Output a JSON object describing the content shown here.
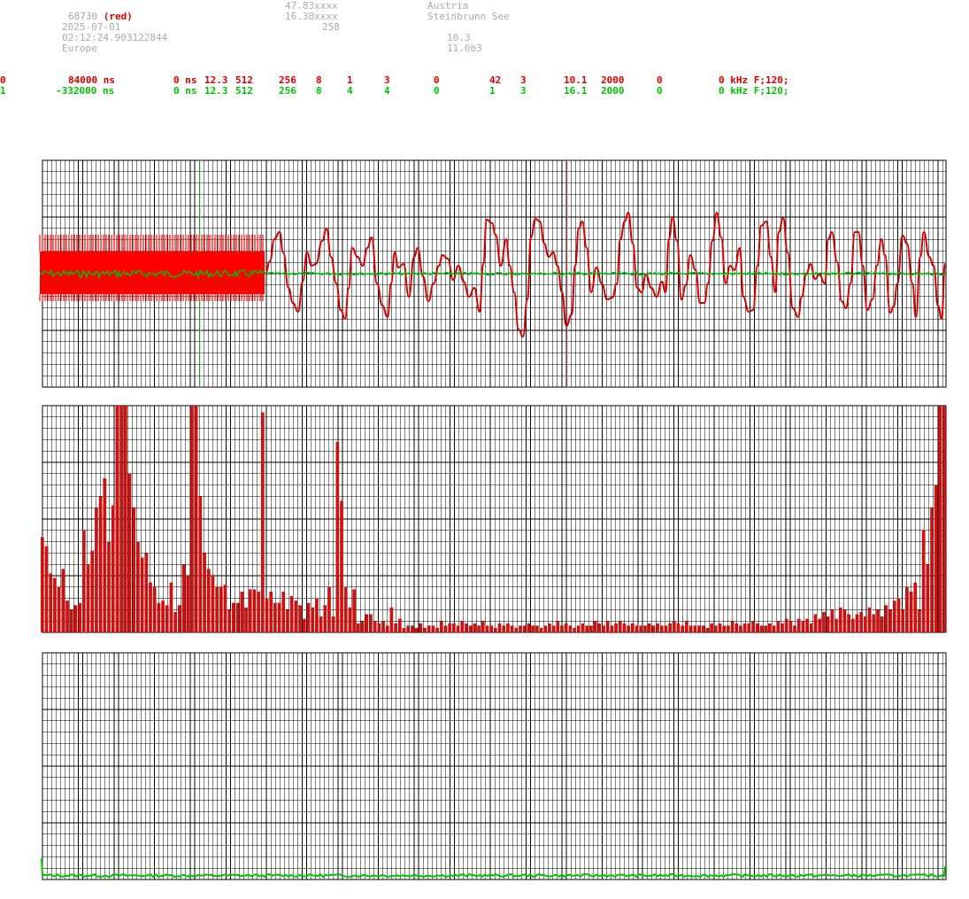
{
  "header": {
    "station_id": "730",
    "station_color_label": "(red)",
    "station_id_2": "687",
    "date": "2025-07-01",
    "time": "02:12:24.903122844",
    "region": "Europe",
    "latitude": "47.83xxxx",
    "longitude": "16.38xxxx",
    "count": "258",
    "country": "Austria",
    "location": "Steinbrunn See",
    "version_a": "10.3",
    "version_b": "11.0b3"
  },
  "channels": [
    {
      "index": "0",
      "offset": "84000 ns",
      "delay": "0 ns",
      "gain": "12.3",
      "fft_size": "512",
      "f1": "256",
      "f2": "8",
      "f3": "1",
      "f4": "3",
      "f5": "0",
      "f6": "42",
      "f7": "3",
      "f8": "10.1",
      "f9": "2000",
      "f10": "0",
      "freq": "0 kHz F;120;",
      "color": "#d40000"
    },
    {
      "index": "1",
      "offset": "-332000 ns",
      "delay": "0 ns",
      "gain": "12.3",
      "fft_size": "512",
      "f1": "256",
      "f2": "8",
      "f3": "4",
      "f4": "4",
      "f5": "0",
      "f6": "1",
      "f7": "3",
      "f8": "16.1",
      "f9": "2000",
      "f10": "0",
      "freq": "0 kHz F;120;",
      "color": "#00c000"
    }
  ],
  "chart_data": [
    {
      "type": "line",
      "panel": "waveform",
      "series": [
        {
          "color": "#d40000",
          "style": "red waveform with dense burst at start"
        },
        {
          "color": "#00c000",
          "style": "green near-flat trace"
        }
      ],
      "grid": true
    },
    {
      "type": "bar",
      "panel": "spectrum",
      "color": "#cc1111",
      "values": [
        42,
        38,
        26,
        24,
        20,
        28,
        14,
        10,
        12,
        13,
        45,
        30,
        36,
        55,
        60,
        68,
        40,
        56,
        100,
        100,
        100,
        70,
        55,
        40,
        33,
        35,
        22,
        20,
        13,
        14,
        12,
        22,
        9,
        12,
        30,
        25,
        100,
        100,
        60,
        35,
        28,
        25,
        20,
        20,
        21,
        10,
        13,
        13,
        18,
        11,
        19,
        19,
        18,
        97,
        15,
        18,
        13,
        13,
        18,
        10,
        16,
        14,
        12,
        6,
        13,
        11,
        15,
        7,
        12,
        20,
        7,
        84,
        58,
        20,
        11,
        19,
        4,
        5,
        8,
        8,
        5,
        4,
        5,
        3,
        11,
        4,
        6,
        2,
        3,
        3,
        2,
        4,
        2,
        3,
        3,
        2,
        5,
        3,
        4,
        4,
        3,
        5,
        4,
        3,
        4,
        3,
        5,
        3,
        3,
        2,
        4,
        3,
        4,
        3,
        2,
        3,
        3,
        4,
        3,
        3,
        2,
        3,
        4,
        3,
        5,
        3,
        4,
        3,
        2,
        3,
        4,
        3,
        3,
        5,
        4,
        3,
        5,
        3,
        4,
        5,
        4,
        3,
        4,
        3,
        3,
        3,
        4,
        3,
        4,
        3,
        3,
        4,
        5,
        4,
        3,
        5,
        3,
        3,
        3,
        3,
        2,
        4,
        3,
        4,
        3,
        3,
        5,
        4,
        3,
        4,
        4,
        5,
        4,
        3,
        3,
        4,
        3,
        5,
        4,
        6,
        5,
        3,
        6,
        5,
        6,
        4,
        8,
        6,
        9,
        7,
        10,
        6,
        11,
        10,
        8,
        6,
        8,
        9,
        7,
        11,
        8,
        10,
        7,
        12,
        10,
        14,
        15,
        10,
        20,
        18,
        22,
        10,
        45,
        30,
        55,
        65,
        100,
        100
      ],
      "ylim": [
        0,
        100
      ],
      "grid": true
    },
    {
      "type": "line",
      "panel": "lower",
      "series": [
        {
          "color": "#00c000",
          "style": "green near-zero trace"
        }
      ],
      "grid": true
    }
  ]
}
